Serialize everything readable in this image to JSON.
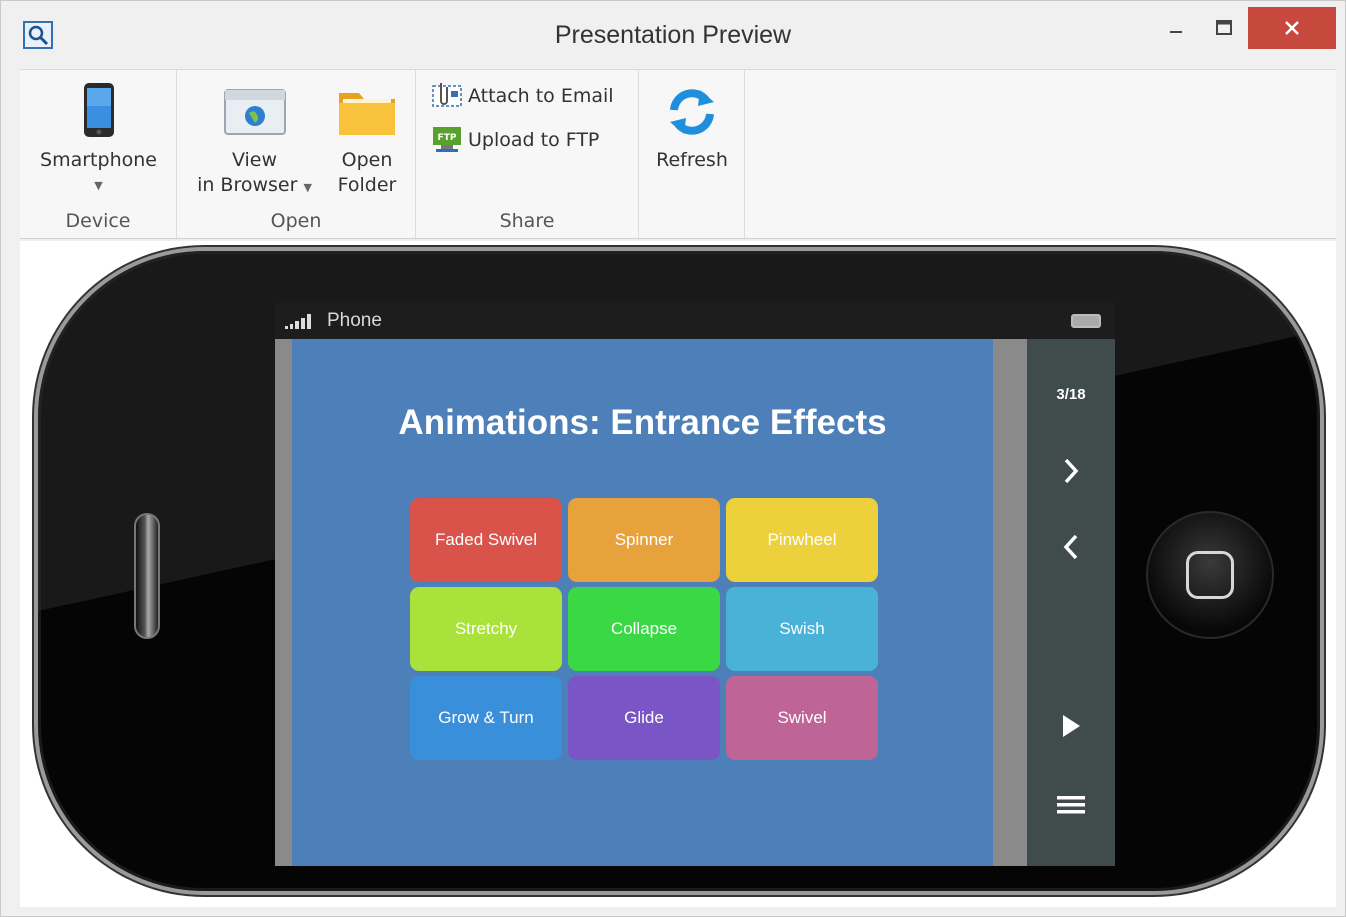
{
  "window": {
    "title": "Presentation Preview"
  },
  "ribbon": {
    "device_group": {
      "label": "Device",
      "smartphone_label": "Smartphone"
    },
    "open_group": {
      "label": "Open",
      "view_line1": "View",
      "view_line2": "in Browser",
      "open_line1": "Open",
      "open_line2": "Folder"
    },
    "share_group": {
      "label": "Share",
      "attach_label": "Attach to Email",
      "upload_label": "Upload to FTP",
      "ftp_badge": "FTP"
    },
    "refresh_label": "Refresh"
  },
  "phone": {
    "carrier": "Phone",
    "slide_title": "Animations: Entrance Effects",
    "counter": "3/18",
    "tiles": [
      {
        "label": "Faded Swivel",
        "color": "#d9534a"
      },
      {
        "label": "Spinner",
        "color": "#e8a23c"
      },
      {
        "label": "Pinwheel",
        "color": "#ecd03c"
      },
      {
        "label": "Stretchy",
        "color": "#a9e23b"
      },
      {
        "label": "Collapse",
        "color": "#3ad844"
      },
      {
        "label": "Swish",
        "color": "#49b3d7"
      },
      {
        "label": "Grow & Turn",
        "color": "#3a8fda"
      },
      {
        "label": "Glide",
        "color": "#7a55c6"
      },
      {
        "label": "Swivel",
        "color": "#bf6497"
      }
    ]
  },
  "colors": {
    "close_button": "#c7493e",
    "slide_bg": "#4d7fb9",
    "nav_panel": "#404c4c"
  },
  "icons": [
    "app-preview-icon",
    "smartphone-icon",
    "browser-icon",
    "folder-icon",
    "attach-email-icon",
    "ftp-icon",
    "refresh-icon",
    "next-icon",
    "prev-icon",
    "play-icon",
    "menu-icon"
  ]
}
